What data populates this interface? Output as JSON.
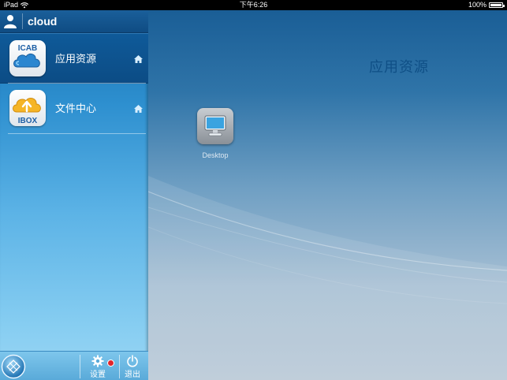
{
  "status_bar": {
    "device": "iPad",
    "time": "下午6:26",
    "battery": "100%"
  },
  "sidebar": {
    "title": "cloud",
    "items": [
      {
        "label": "应用资源",
        "icon_text": "ICAB",
        "icon": "cloud-icon",
        "active": true
      },
      {
        "label": "文件中心",
        "icon_text": "IBOX",
        "icon": "cloud-upload-icon",
        "active": false
      }
    ]
  },
  "toolbar": {
    "settings_label": "设置",
    "logout_label": "退出"
  },
  "main": {
    "title": "应用资源",
    "desktop_label": "Desktop"
  },
  "colors": {
    "sidebar_active": "#0f5a99",
    "main_title": "#0f4f86",
    "notification_dot": "#e1252b"
  }
}
